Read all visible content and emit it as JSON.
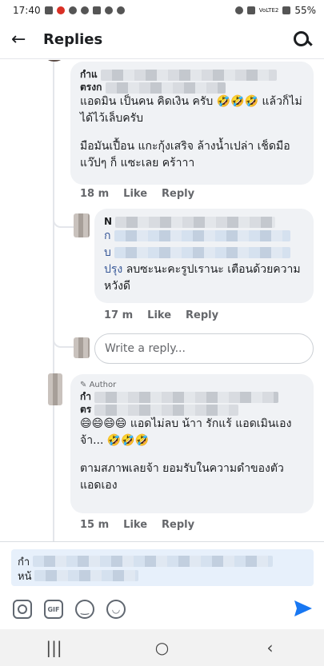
{
  "status_bar": {
    "time": "17:40",
    "network": "VoLTE2",
    "battery": "55%"
  },
  "app_bar": {
    "back_glyph": "←",
    "title": "Replies"
  },
  "comments": [
    {
      "name_prefix": "กําแ",
      "name_line2_prefix": "ตรงก",
      "text_1": "แอดมิน เป็นคน คิดเงิน ครับ 🤣🤣🤣 แล้วก็ไม่ได้ไว้เล็บครับ",
      "text_2": "มือมันเปื้อน แกะกุ้งเสริจ ล้างน้ำเปล่า เช็ดมือแว๊ปๆ ก็ แซะเลย คร้าาา",
      "time": "18 m",
      "like": "Like",
      "reply": "Reply"
    },
    {
      "name_prefix": "N",
      "line_prefix_1": "ก",
      "line_prefix_2": "บ",
      "link_word": "ปรุง",
      "text": "ลบซะนะคะรูปเรานะ  เตือนด้วยความหวังดี",
      "time": "17 m",
      "like": "Like",
      "reply": "Reply"
    },
    {
      "author_label": "Author",
      "name_prefix": "กํา",
      "name_line2_prefix": "ตร",
      "text_1": "😄😄😄😄  แอดไม่ลบ น้าา รักแร้ แอดเมินเอง จ้า... 🤣🤣🤣",
      "text_2": "ตามสภาพเลยจ้า ยอมรับในความดำของตัวแอดเอง",
      "time": "15 m",
      "like": "Like",
      "reply": "Reply"
    }
  ],
  "reply_field": {
    "placeholder": "Write a reply..."
  },
  "composer": {
    "line_1_prefix": "กํา",
    "line_2_prefix": "หน้",
    "tools": [
      "camera-icon",
      "gif-icon",
      "emoji-icon",
      "sticker-icon"
    ],
    "gif_label": "GIF"
  },
  "nav": {
    "recents": "|||",
    "home": "○",
    "back": "‹"
  },
  "colors": {
    "link": "#385898",
    "send": "#1877f2",
    "bubble": "#f0f2f5",
    "meta": "#65676b"
  }
}
